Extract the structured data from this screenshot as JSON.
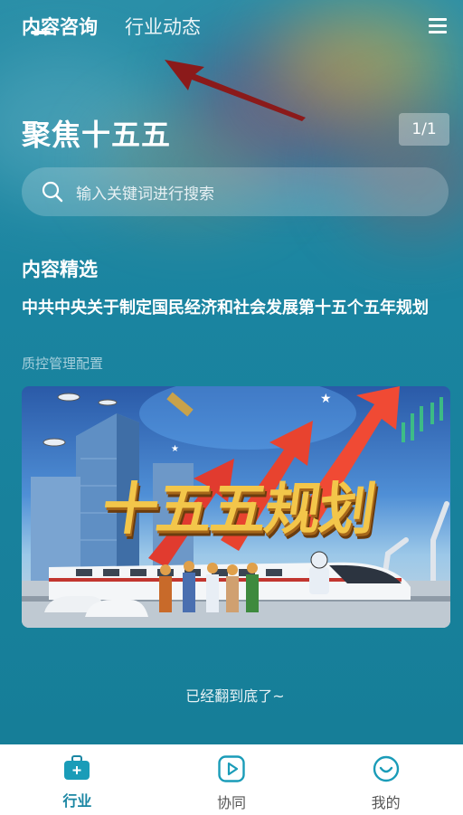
{
  "header": {
    "tabs": [
      {
        "label": "内容咨询",
        "active": true
      },
      {
        "label": "行业动态",
        "active": false
      }
    ],
    "menu_icon": "hamburger-menu-icon"
  },
  "page": {
    "title": "聚焦十五五",
    "counter": "1/1"
  },
  "search": {
    "placeholder": "输入关键词进行搜索",
    "icon": "search-icon"
  },
  "section": {
    "title": "内容精选"
  },
  "article": {
    "title": "中共中央关于制定国民经济和社会发展第十五个五年规划",
    "subtitle": "质控管理配置",
    "image_text": "十五五规划"
  },
  "list_end": "已经翻到底了~",
  "bottom_nav": [
    {
      "label": "行业",
      "icon": "briefcase-icon",
      "active": true
    },
    {
      "label": "协同",
      "icon": "play-icon",
      "active": false
    },
    {
      "label": "我的",
      "icon": "smile-icon",
      "active": false
    }
  ],
  "colors": {
    "background": "#167e98",
    "accent": "#1a86a3",
    "annotation_arrow": "#8b1a1a"
  }
}
